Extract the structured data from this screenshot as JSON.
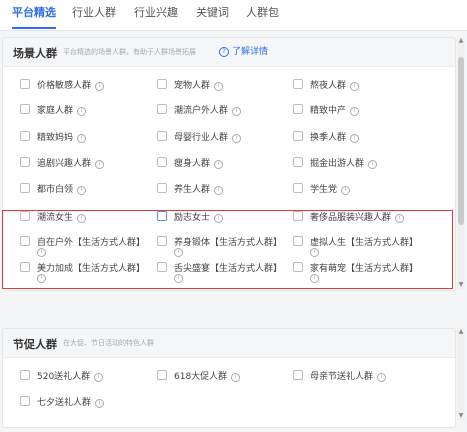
{
  "tabs": [
    {
      "label": "平台精选"
    },
    {
      "label": "行业人群"
    },
    {
      "label": "行业兴趣"
    },
    {
      "label": "关键词"
    },
    {
      "label": "人群包"
    }
  ],
  "scene_panel": {
    "title": "场景人群",
    "desc": "平台精选的场景人群，有助于人群场景拓展",
    "learn_more": "了解详情",
    "items": [
      {
        "label": "价格敏感人群"
      },
      {
        "label": "宠物人群"
      },
      {
        "label": "熬夜人群"
      },
      {
        "label": "家庭人群"
      },
      {
        "label": "潮流户外人群"
      },
      {
        "label": "精致中产"
      },
      {
        "label": "精致妈妈"
      },
      {
        "label": "母婴行业人群"
      },
      {
        "label": "换季人群"
      },
      {
        "label": "追剧兴趣人群"
      },
      {
        "label": "瘦身人群"
      },
      {
        "label": "掘金出游人群"
      },
      {
        "label": "都市白领"
      },
      {
        "label": "养生人群"
      },
      {
        "label": "学生党"
      },
      {
        "label": "潮流女生"
      },
      {
        "label": "励志女士"
      },
      {
        "label": "奢侈品服装兴趣人群"
      },
      {
        "label": "自在户外【生活方式人群】"
      },
      {
        "label": "养身锻体【生活方式人群】"
      },
      {
        "label": "虚拟人生【生活方式人群】"
      },
      {
        "label": "美力加成【生活方式人群】"
      },
      {
        "label": "舌尖盛宴【生活方式人群】"
      },
      {
        "label": "家有萌宠【生活方式人群】"
      }
    ]
  },
  "promo_panel": {
    "title": "节促人群",
    "desc": "在大促、节日活动的特色人群",
    "items": [
      {
        "label": "520送礼人群"
      },
      {
        "label": "618大促人群"
      },
      {
        "label": "母亲节送礼人群"
      },
      {
        "label": "七夕送礼人群"
      }
    ]
  },
  "info_glyph": "i",
  "colors": {
    "accent": "#2f6fec",
    "highlight": "#e53935"
  }
}
